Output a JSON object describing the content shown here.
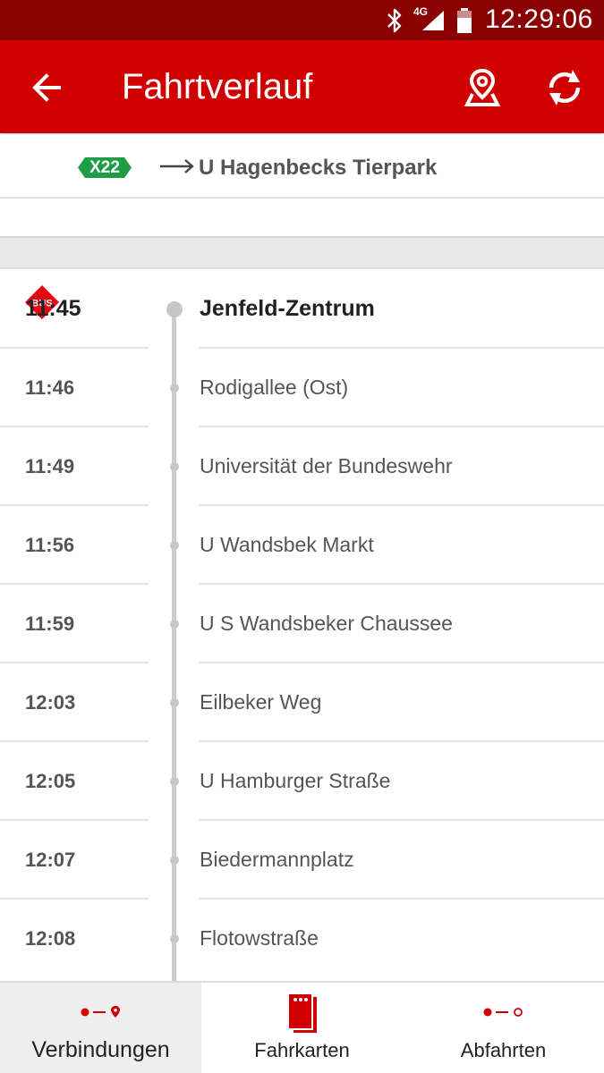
{
  "status_bar": {
    "network": "4G",
    "time": "12:29:06",
    "icons": [
      "bluetooth-icon",
      "signal-icon",
      "battery-icon"
    ]
  },
  "toolbar": {
    "title": "Fahrtverlauf",
    "icons": [
      "back-arrow-icon",
      "map-pin-icon",
      "refresh-icon"
    ]
  },
  "route": {
    "mode_badge": "BUS",
    "line": "X22",
    "arrow": "⟶",
    "destination": "U Hagenbecks Tierpark"
  },
  "stops": [
    {
      "time": "11:45",
      "name": "Jenfeld-Zentrum"
    },
    {
      "time": "11:46",
      "name": "Rodigallee (Ost)"
    },
    {
      "time": "11:49",
      "name": "Universität der Bundeswehr"
    },
    {
      "time": "11:56",
      "name": "U Wandsbek Markt"
    },
    {
      "time": "11:59",
      "name": "U S Wandsbeker Chaussee"
    },
    {
      "time": "12:03",
      "name": "Eilbeker Weg"
    },
    {
      "time": "12:05",
      "name": "U Hamburger Straße"
    },
    {
      "time": "12:07",
      "name": "Biedermannplatz"
    },
    {
      "time": "12:08",
      "name": "Flotowstraße"
    }
  ],
  "bottom_nav": [
    {
      "label": "Verbindungen",
      "icon": "connections-icon",
      "active": true
    },
    {
      "label": "Fahrkarten",
      "icon": "tickets-icon",
      "active": false
    },
    {
      "label": "Abfahrten",
      "icon": "departures-icon",
      "active": false
    }
  ],
  "colors": {
    "status_bar": "#8b0000",
    "primary": "#d10000",
    "line_badge": "#1f9c46",
    "bus_badge": "#e30613"
  }
}
